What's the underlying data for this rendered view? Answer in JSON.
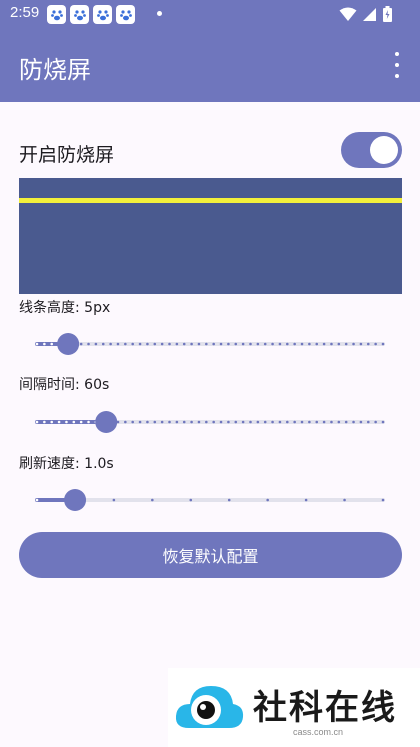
{
  "status_bar": {
    "time": "2:59",
    "notification_icons": [
      "paw-icon",
      "paw-icon",
      "paw-icon",
      "paw-icon"
    ],
    "system_icons": [
      "wifi-icon",
      "signal-icon",
      "battery-charging-icon"
    ]
  },
  "app_bar": {
    "title": "防烧屏",
    "overflow_icon": "more-vert-icon"
  },
  "toggle": {
    "label": "开启防烧屏",
    "enabled": true
  },
  "preview": {
    "background_color": "#4a5a8f",
    "line_color": "#f3f03b"
  },
  "sliders": [
    {
      "label": "线条高度: 5px",
      "value_fraction": 0.09,
      "tick_count": 48
    },
    {
      "label": "间隔时间: 60s",
      "value_fraction": 0.2,
      "tick_count": 48
    },
    {
      "label": "刷新速度: 1.0s",
      "value_fraction": 0.11,
      "tick_count": 10
    }
  ],
  "reset_button": {
    "label": "恢复默认配置"
  },
  "watermark": {
    "text": "社科在线",
    "url": "cass.com.cn"
  },
  "colors": {
    "primary": "#6f76bd",
    "primary_dark": "#4a5a8f",
    "track_inactive": "#e2e2ec",
    "background": "#fdf9fe"
  }
}
